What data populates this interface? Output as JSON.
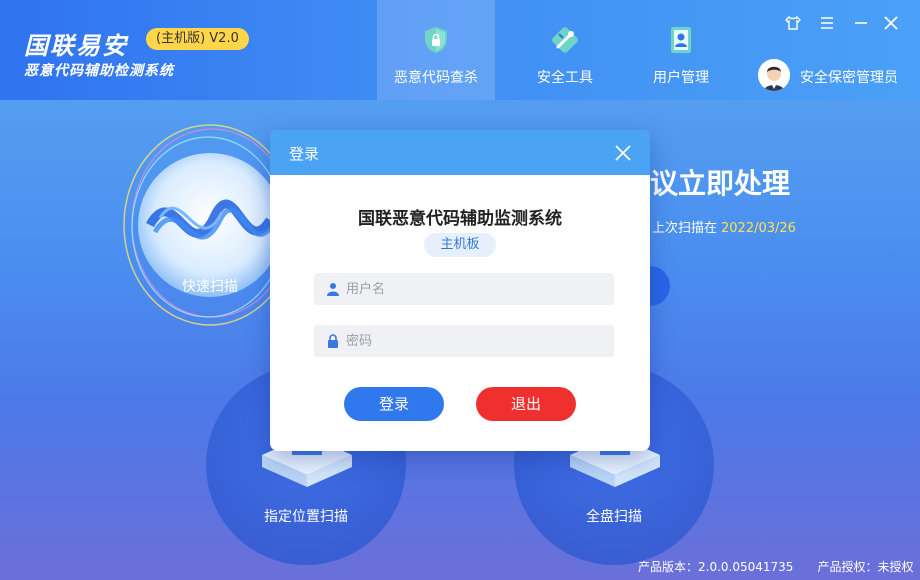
{
  "header": {
    "brand_title": "国联易安",
    "version_badge": "(主机版) V2.0",
    "brand_subtitle": "恶意代码辅助检测系统",
    "tabs": [
      {
        "label": "恶意代码查杀",
        "icon": "shield-lock-icon",
        "active": true
      },
      {
        "label": "安全工具",
        "icon": "tools-icon",
        "active": false
      },
      {
        "label": "用户管理",
        "icon": "user-card-icon",
        "active": false
      }
    ],
    "user_name": "安全保密管理员",
    "window_controls": [
      "skin-icon",
      "menu-icon",
      "minimize-icon",
      "close-icon"
    ]
  },
  "main": {
    "quick_scan_label": "快速扫描",
    "custom_scan_label": "指定位置扫描",
    "full_scan_label": "全盘扫描",
    "headline_partial": "议立即处理",
    "last_scan_label": "上次扫描在",
    "last_scan_date": "2022/03/26"
  },
  "footer": {
    "product_version": "产品版本：2.0.0.05041735",
    "license": "产品授权：未授权"
  },
  "dialog": {
    "title": "登录",
    "system_name": "国联恶意代码辅助监测系统",
    "edition_tag": "主机板",
    "username_placeholder": "用户名",
    "password_placeholder": "密码",
    "login_label": "登录",
    "exit_label": "退出"
  },
  "colors": {
    "header_blue": "#3f8bf4",
    "dialog_header": "#4aa3f5",
    "login_button": "#2f78ee",
    "exit_button": "#f0302f",
    "badge_yellow": "#ffd54a",
    "date_yellow": "#ffe14d"
  }
}
